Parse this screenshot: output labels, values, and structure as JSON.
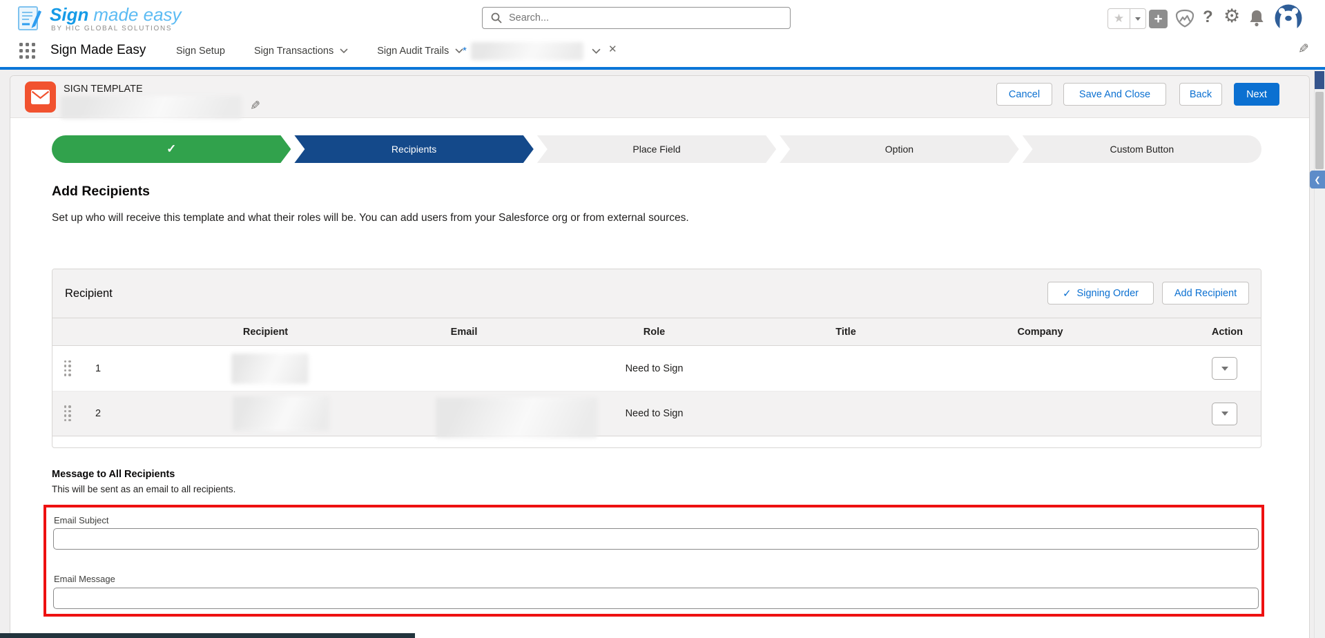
{
  "global_header": {
    "logo": {
      "brand_primary": "Sign",
      "brand_secondary": "made easy",
      "brand_subtitle": "BY HIC GLOBAL SOLUTIONS"
    },
    "search_placeholder": "Search..."
  },
  "nav": {
    "app_name": "Sign Made Easy",
    "tabs": [
      {
        "label": "Sign Setup",
        "has_menu": false
      },
      {
        "label": "Sign Transactions",
        "has_menu": true
      },
      {
        "label": "Sign Audit Trails",
        "has_menu": true
      }
    ],
    "temp_tab": {
      "prefix": "*",
      "label": "",
      "redacted": true
    }
  },
  "record_header": {
    "entity_label": "SIGN TEMPLATE",
    "record_name": "",
    "record_name_redacted": true,
    "actions": {
      "cancel": "Cancel",
      "save_and_close": "Save And Close",
      "back": "Back",
      "next": "Next"
    }
  },
  "path": {
    "steps": [
      {
        "label": "",
        "state": "complete"
      },
      {
        "label": "Recipients",
        "state": "current"
      },
      {
        "label": "Place Field",
        "state": "incomplete"
      },
      {
        "label": "Option",
        "state": "incomplete"
      },
      {
        "label": "Custom Button",
        "state": "incomplete"
      }
    ]
  },
  "intro": {
    "title": "Add Recipients",
    "description": "Set up who will receive this template and what their roles will be. You can add users from your Salesforce org or from external sources."
  },
  "recipient_panel": {
    "title": "Recipient",
    "signing_order_button": "Signing Order",
    "add_recipient_button": "Add Recipient",
    "columns": [
      "Recipient",
      "Email",
      "Role",
      "Title",
      "Company",
      "Action"
    ],
    "rows": [
      {
        "order": "1",
        "role": "Need to Sign",
        "recipient_redacted": true,
        "email_redacted": false
      },
      {
        "order": "2",
        "role": "Need to Sign",
        "recipient_redacted": true,
        "email_redacted": true
      }
    ]
  },
  "message_section": {
    "title": "Message to All Recipients",
    "subtitle": "This will be sent as an email to all recipients.",
    "email_subject_label": "Email Subject",
    "email_subject_value": "",
    "email_message_label": "Email Message",
    "email_message_value": ""
  },
  "glyphs": {
    "star": "★",
    "plus": "+",
    "question": "?",
    "gear": "⚙",
    "pencil": "✎",
    "close": "✕",
    "check": "✓",
    "chevron_left": "❮",
    "asterisk": "*"
  },
  "colors": {
    "brand_blue": "#0b70d1",
    "nav_underline": "#0b76d8",
    "path_complete_green": "#31a24c",
    "path_current_navy": "#14498a",
    "template_icon_orange": "#f1522f",
    "annotation_red": "#ee1111"
  }
}
